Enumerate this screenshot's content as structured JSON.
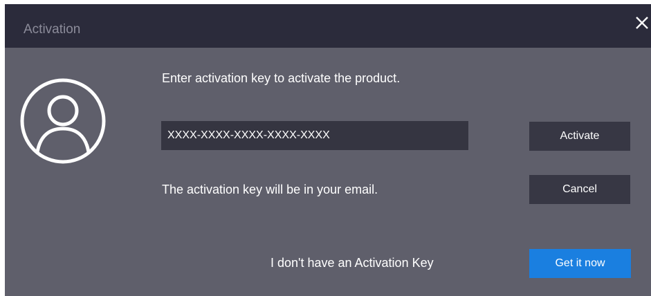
{
  "window": {
    "title": "Activation",
    "close_icon": "close-icon"
  },
  "avatar_icon": "user-avatar-icon",
  "prompt_text": "Enter activation key to activate the product.",
  "key_input": {
    "placeholder": "XXXX-XXXX-XXXX-XXXX-XXXX",
    "value": ""
  },
  "buttons": {
    "activate": "Activate",
    "cancel": "Cancel",
    "get_it_now": "Get it now"
  },
  "hint_text": "The activation key will be in your email.",
  "no_key_text": "I don't have an Activation Key",
  "colors": {
    "titlebar": "#2b2b3b",
    "body": "#5f5f6b",
    "input_bg": "#353541",
    "button_dark": "#373744",
    "accent": "#1a7fe0"
  }
}
